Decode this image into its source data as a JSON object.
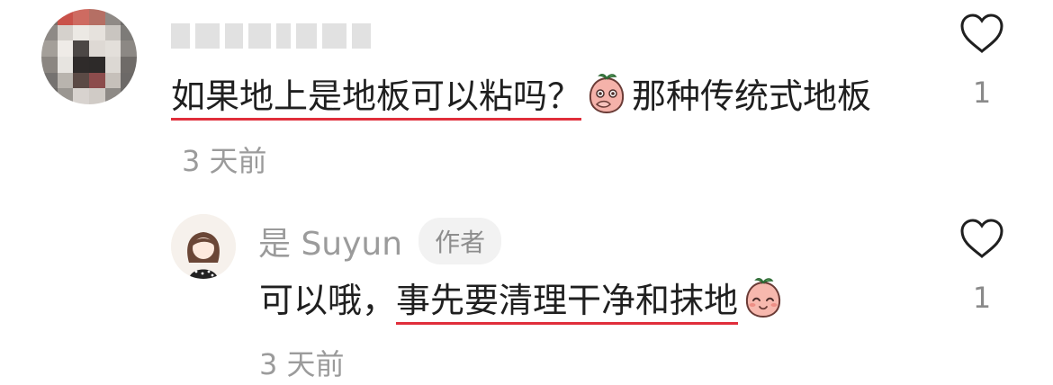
{
  "comment": {
    "avatar_pixels": [
      "#7a6f69",
      "#c9524a",
      "#ce6b61",
      "#b56f64",
      "#8f8a86",
      "#6d6b69",
      "#8e8a86",
      "#d5d1cc",
      "#ece9e4",
      "#e6e2dd",
      "#c9c5c0",
      "#7d7b78",
      "#a49f99",
      "#efebe7",
      "#4c4745",
      "#ded9d4",
      "#e3dfda",
      "#8c8884",
      "#8b8681",
      "#e7e4e0",
      "#2f2b2a",
      "#2d2a29",
      "#dcd8d3",
      "#6f6b68",
      "#757270",
      "#b9b4ae",
      "#5b4a45",
      "#8c4c4c",
      "#c6c0ba",
      "#6c6967",
      "#6d6a68",
      "#9a9691",
      "#d8d3cf",
      "#d0cbc6",
      "#8e8a86",
      "#6e6c6a"
    ],
    "text_part1": "如果地上是地板可以粘吗？",
    "emoji_name": "peach-shy-emoji",
    "text_part2": "那种传统式地板",
    "time": "3 天前",
    "likes": "1"
  },
  "reply": {
    "name": "是 Suyun",
    "badge": "作者",
    "text_part1": "可以哦，",
    "text_part2": "事先要清理干净和抹地",
    "emoji_name": "peach-smile-emoji",
    "time": "3 天前",
    "likes": "1"
  }
}
